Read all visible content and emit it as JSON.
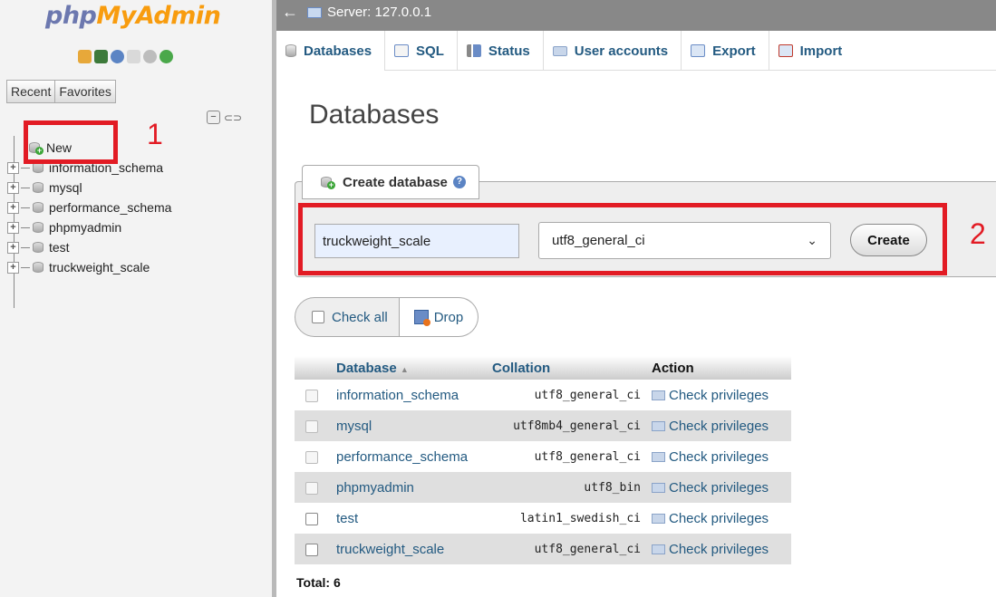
{
  "nav": {
    "logo_part1": "php",
    "logo_part2": "MyAdmin",
    "recent_label": "Recent",
    "favorites_label": "Favorites",
    "collapse_symbol": "−",
    "new_label": "New",
    "databases": [
      "information_schema",
      "mysql",
      "performance_schema",
      "phpmyadmin",
      "test",
      "truckweight_scale"
    ],
    "expander_symbol": "+"
  },
  "annotations": {
    "num1": "1",
    "num2": "2",
    "color": "#e21b24"
  },
  "server_bar": {
    "back_arrow": "←",
    "server_label": "Server: 127.0.0.1"
  },
  "tabs": [
    {
      "label": "Databases",
      "icon": "database-icon"
    },
    {
      "label": "SQL",
      "icon": "sql-icon"
    },
    {
      "label": "Status",
      "icon": "status-icon"
    },
    {
      "label": "User accounts",
      "icon": "users-icon"
    },
    {
      "label": "Export",
      "icon": "export-icon"
    },
    {
      "label": "Import",
      "icon": "import-icon"
    }
  ],
  "main": {
    "title": "Databases",
    "create": {
      "legend": "Create database",
      "help_symbol": "?",
      "db_name_value": "truckweight_scale",
      "collation_value": "utf8_general_ci",
      "chevron": "⌄",
      "button_label": "Create"
    },
    "check_all_label": "Check all",
    "drop_label": "Drop",
    "table": {
      "headers": {
        "database": "Database",
        "sort_indicator": "▲",
        "collation": "Collation",
        "action": "Action"
      },
      "rows": [
        {
          "name": "information_schema",
          "collation": "utf8_general_ci",
          "action": "Check privileges"
        },
        {
          "name": "mysql",
          "collation": "utf8mb4_general_ci",
          "action": "Check privileges"
        },
        {
          "name": "performance_schema",
          "collation": "utf8_general_ci",
          "action": "Check privileges"
        },
        {
          "name": "phpmyadmin",
          "collation": "utf8_bin",
          "action": "Check privileges"
        },
        {
          "name": "test",
          "collation": "latin1_swedish_ci",
          "action": "Check privileges"
        },
        {
          "name": "truckweight_scale",
          "collation": "utf8_general_ci",
          "action": "Check privileges"
        }
      ]
    },
    "total_label": "Total: 6"
  },
  "colors": {
    "link": "#235a81",
    "logo_php": "#6c78af",
    "logo_myadmin": "#f89c0e"
  }
}
